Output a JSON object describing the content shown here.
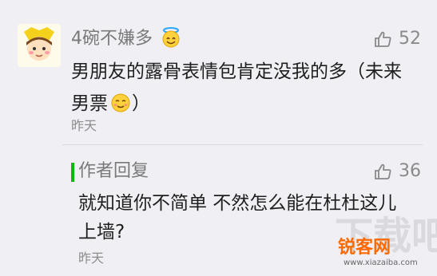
{
  "comment": {
    "nickname": "4碗不嫌多",
    "nickname_emoji": "halo-smile-emoji",
    "like_count": "52",
    "text": "男朋友的露骨表情包肯定没我的多（未来男票",
    "text_emoji": "blush-smile-emoji",
    "text_end": "）",
    "timestamp": "昨天"
  },
  "reply": {
    "author_label": "作者回复",
    "like_count": "36",
    "text": "就知道你不简单 不然怎么能在杜杜这儿上墙?",
    "timestamp": "昨天"
  },
  "watermark": {
    "big": "下载吧",
    "badge": "锐客网",
    "url": "www.xiazaiba.com"
  },
  "colors": {
    "background": "#efeff4",
    "accent_green": "#09bb07",
    "watermark_orange": "#ff6a00"
  }
}
